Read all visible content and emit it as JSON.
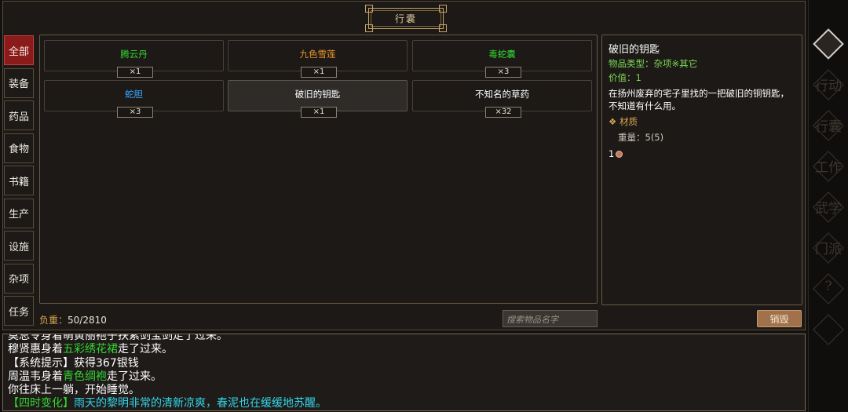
{
  "title": "行囊",
  "categories": [
    {
      "label": "全部",
      "active": true
    },
    {
      "label": "装备",
      "active": false
    },
    {
      "label": "药品",
      "active": false
    },
    {
      "label": "食物",
      "active": false
    },
    {
      "label": "书籍",
      "active": false
    },
    {
      "label": "生产",
      "active": false
    },
    {
      "label": "设施",
      "active": false
    },
    {
      "label": "杂项",
      "active": false
    },
    {
      "label": "任务",
      "active": false
    }
  ],
  "items": [
    {
      "name": "腾云丹",
      "qty": "×1",
      "color": "#33d633",
      "selected": false
    },
    {
      "name": "九色雪莲",
      "qty": "×1",
      "color": "#e8932b",
      "selected": false
    },
    {
      "name": "毒蛇囊",
      "qty": "×3",
      "color": "#33d633",
      "selected": false
    },
    {
      "name": "蛇胆",
      "qty": "×3",
      "color": "#3aa6ff",
      "selected": false
    },
    {
      "name": "破旧的钥匙",
      "qty": "×1",
      "color": "#ffffff",
      "selected": true
    },
    {
      "name": "不知名的草药",
      "qty": "×32",
      "color": "#ffffff",
      "selected": false
    }
  ],
  "detail": {
    "name": "破旧的钥匙",
    "type": "物品类型：杂项※其它",
    "value": "价值：1",
    "desc": "在扬州废弃的宅子里找的一把破旧的铜钥匙，不知道有什么用。",
    "material": "❖ 材质",
    "weight": "重量：5(5)",
    "price": "1"
  },
  "load": {
    "label": "负重：",
    "value": "50/2810"
  },
  "search_placeholder": "搜索物品名字",
  "destroy_label": "销毁",
  "log": [
    [
      {
        "t": "莫总令身着萌黄丽袍子扶紫剑宝剑走了过来。",
        "c": "#ffffff"
      }
    ],
    [
      {
        "t": "穆贤惠身着",
        "c": "#ffffff"
      },
      {
        "t": "五彩绣花裙",
        "c": "#33d633"
      },
      {
        "t": "走了过来。",
        "c": "#ffffff"
      }
    ],
    [
      {
        "t": "【系统提示】获得367银钱",
        "c": "#ffffff"
      }
    ],
    [
      {
        "t": "周温韦身着",
        "c": "#ffffff"
      },
      {
        "t": "青色绸袍",
        "c": "#33d633"
      },
      {
        "t": "走了过来。",
        "c": "#ffffff"
      }
    ],
    [
      {
        "t": "你往床上一躺，开始睡觉。",
        "c": "#ffffff"
      }
    ],
    [
      {
        "t": "【四时变化】",
        "c": "#33d633"
      },
      {
        "t": "雨天的黎明非常的清新凉爽，春泥也在缓缓地苏醒。",
        "c": "#33d4e8"
      }
    ]
  ],
  "rail": [
    {
      "label": "",
      "icon": "emblem-icon"
    },
    {
      "label": "行动",
      "icon": "action-icon"
    },
    {
      "label": "行囊",
      "icon": "bag-icon"
    },
    {
      "label": "工作",
      "icon": "work-icon"
    },
    {
      "label": "武学",
      "icon": "martial-icon"
    },
    {
      "label": "门派",
      "icon": "sect-icon"
    },
    {
      "label": "?",
      "icon": "help-icon"
    },
    {
      "label": "",
      "icon": "settings-icon"
    }
  ]
}
